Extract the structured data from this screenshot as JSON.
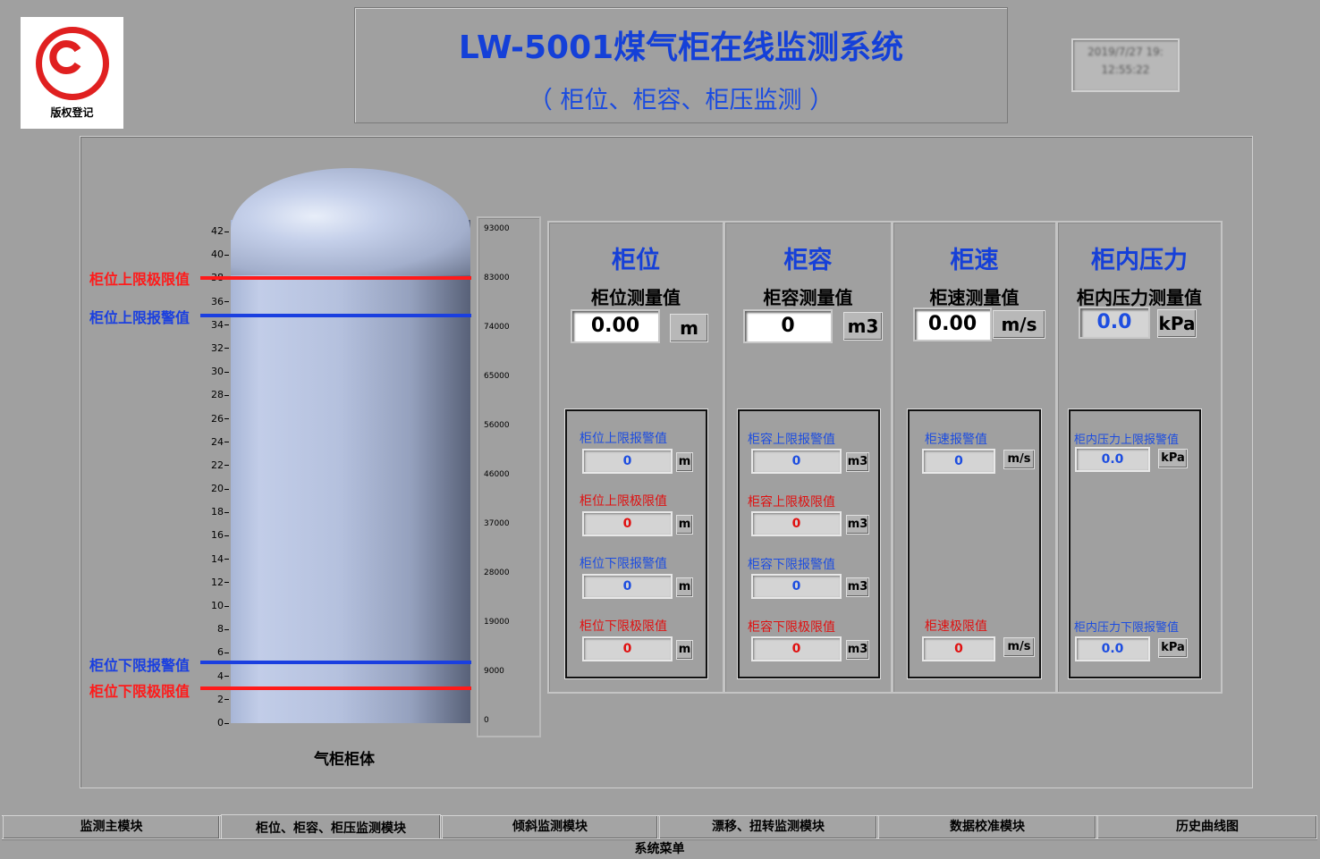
{
  "logo": {
    "text": "版权登记",
    "icon": "copyright-icon",
    "color": "#e02020"
  },
  "header": {
    "title": "LW-5001煤气柜在线监测系统",
    "subtitle": "（ 柜位、柜容、柜压监测 ）",
    "datetime_line1": "2019/7/27 19:",
    "datetime_line2": "12:55:22"
  },
  "tank": {
    "label": "气柜柜体",
    "left_scale": [
      "42",
      "40",
      "38",
      "36",
      "34",
      "32",
      "30",
      "28",
      "26",
      "24",
      "22",
      "20",
      "18",
      "16",
      "14",
      "12",
      "10",
      "8",
      "6",
      "4",
      "2",
      "0"
    ],
    "right_scale": [
      "93000",
      "83000",
      "74000",
      "65000",
      "56000",
      "46000",
      "37000",
      "28000",
      "19000",
      "9000",
      "0"
    ],
    "limits": {
      "upper_limit": "柜位上限极限值",
      "upper_alarm": "柜位上限报警值",
      "lower_alarm": "柜位下限报警值",
      "lower_limit": "柜位下限极限值"
    },
    "colors": {
      "limit": "#ff1a1a",
      "alarm": "#1a3fe0"
    }
  },
  "level": {
    "title": "柜位",
    "meas_label": "柜位测量值",
    "value": "0.00",
    "unit": "m",
    "upper_alarm_label": "柜位上限报警值",
    "upper_alarm_value": "0",
    "upper_limit_label": "柜位上限极限值",
    "upper_limit_value": "0",
    "lower_alarm_label": "柜位下限报警值",
    "lower_alarm_value": "0",
    "lower_limit_label": "柜位下限极限值",
    "lower_limit_value": "0"
  },
  "volume": {
    "title": "柜容",
    "meas_label": "柜容测量值",
    "value": "0",
    "unit": "m3",
    "upper_alarm_label": "柜容上限报警值",
    "upper_alarm_value": "0",
    "upper_limit_label": "柜容上限极限值",
    "upper_limit_value": "0",
    "lower_alarm_label": "柜容下限报警值",
    "lower_alarm_value": "0",
    "lower_limit_label": "柜容下限极限值",
    "lower_limit_value": "0"
  },
  "speed": {
    "title": "柜速",
    "meas_label": "柜速测量值",
    "value": "0.00",
    "unit": "m/s",
    "alarm_label": "柜速报警值",
    "alarm_value": "0",
    "limit_label": "柜速极限值",
    "limit_value": "0"
  },
  "pressure": {
    "title": "柜内压力",
    "meas_label": "柜内压力测量值",
    "value": "0.0",
    "unit": "kPa",
    "upper_alarm_label": "柜内压力上限报警值",
    "upper_alarm_value": "0.0",
    "lower_alarm_label": "柜内压力下限报警值",
    "lower_alarm_value": "0.0"
  },
  "tabs": [
    {
      "label": "监测主模块"
    },
    {
      "label": "柜位、柜容、柜压监测模块"
    },
    {
      "label": "倾斜监测模块"
    },
    {
      "label": "漂移、扭转监测模块"
    },
    {
      "label": "数据校准模块"
    },
    {
      "label": "历史曲线图"
    }
  ],
  "system_menu": "系统菜单"
}
